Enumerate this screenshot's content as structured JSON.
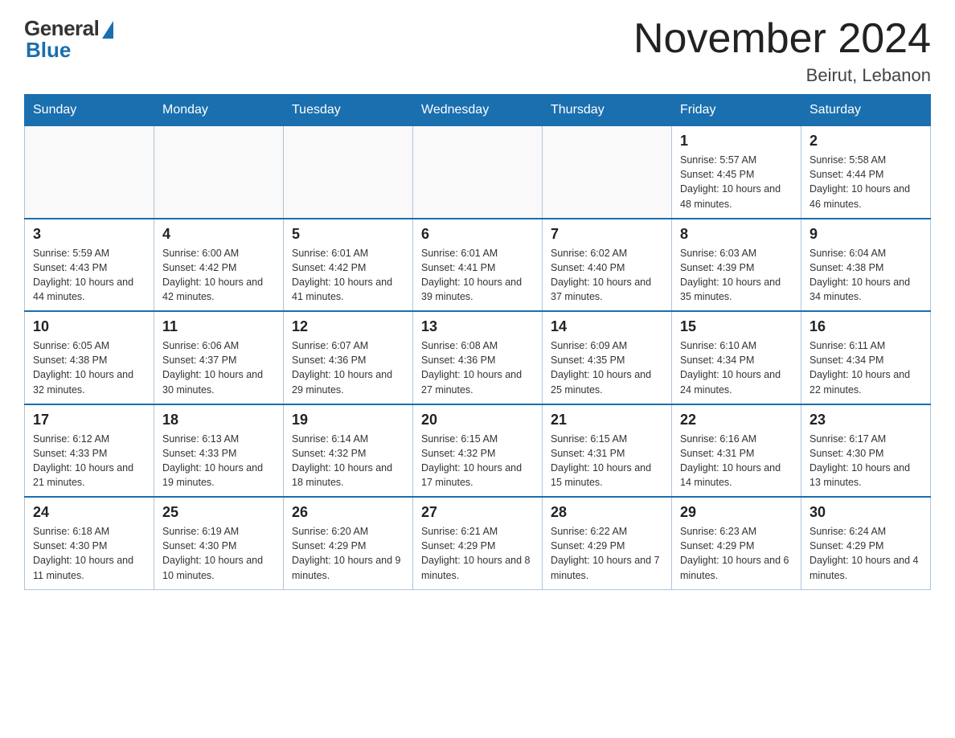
{
  "logo": {
    "general": "General",
    "blue": "Blue"
  },
  "header": {
    "month_year": "November 2024",
    "location": "Beirut, Lebanon"
  },
  "weekdays": [
    "Sunday",
    "Monday",
    "Tuesday",
    "Wednesday",
    "Thursday",
    "Friday",
    "Saturday"
  ],
  "weeks": [
    [
      {
        "day": "",
        "info": ""
      },
      {
        "day": "",
        "info": ""
      },
      {
        "day": "",
        "info": ""
      },
      {
        "day": "",
        "info": ""
      },
      {
        "day": "",
        "info": ""
      },
      {
        "day": "1",
        "info": "Sunrise: 5:57 AM\nSunset: 4:45 PM\nDaylight: 10 hours and 48 minutes."
      },
      {
        "day": "2",
        "info": "Sunrise: 5:58 AM\nSunset: 4:44 PM\nDaylight: 10 hours and 46 minutes."
      }
    ],
    [
      {
        "day": "3",
        "info": "Sunrise: 5:59 AM\nSunset: 4:43 PM\nDaylight: 10 hours and 44 minutes."
      },
      {
        "day": "4",
        "info": "Sunrise: 6:00 AM\nSunset: 4:42 PM\nDaylight: 10 hours and 42 minutes."
      },
      {
        "day": "5",
        "info": "Sunrise: 6:01 AM\nSunset: 4:42 PM\nDaylight: 10 hours and 41 minutes."
      },
      {
        "day": "6",
        "info": "Sunrise: 6:01 AM\nSunset: 4:41 PM\nDaylight: 10 hours and 39 minutes."
      },
      {
        "day": "7",
        "info": "Sunrise: 6:02 AM\nSunset: 4:40 PM\nDaylight: 10 hours and 37 minutes."
      },
      {
        "day": "8",
        "info": "Sunrise: 6:03 AM\nSunset: 4:39 PM\nDaylight: 10 hours and 35 minutes."
      },
      {
        "day": "9",
        "info": "Sunrise: 6:04 AM\nSunset: 4:38 PM\nDaylight: 10 hours and 34 minutes."
      }
    ],
    [
      {
        "day": "10",
        "info": "Sunrise: 6:05 AM\nSunset: 4:38 PM\nDaylight: 10 hours and 32 minutes."
      },
      {
        "day": "11",
        "info": "Sunrise: 6:06 AM\nSunset: 4:37 PM\nDaylight: 10 hours and 30 minutes."
      },
      {
        "day": "12",
        "info": "Sunrise: 6:07 AM\nSunset: 4:36 PM\nDaylight: 10 hours and 29 minutes."
      },
      {
        "day": "13",
        "info": "Sunrise: 6:08 AM\nSunset: 4:36 PM\nDaylight: 10 hours and 27 minutes."
      },
      {
        "day": "14",
        "info": "Sunrise: 6:09 AM\nSunset: 4:35 PM\nDaylight: 10 hours and 25 minutes."
      },
      {
        "day": "15",
        "info": "Sunrise: 6:10 AM\nSunset: 4:34 PM\nDaylight: 10 hours and 24 minutes."
      },
      {
        "day": "16",
        "info": "Sunrise: 6:11 AM\nSunset: 4:34 PM\nDaylight: 10 hours and 22 minutes."
      }
    ],
    [
      {
        "day": "17",
        "info": "Sunrise: 6:12 AM\nSunset: 4:33 PM\nDaylight: 10 hours and 21 minutes."
      },
      {
        "day": "18",
        "info": "Sunrise: 6:13 AM\nSunset: 4:33 PM\nDaylight: 10 hours and 19 minutes."
      },
      {
        "day": "19",
        "info": "Sunrise: 6:14 AM\nSunset: 4:32 PM\nDaylight: 10 hours and 18 minutes."
      },
      {
        "day": "20",
        "info": "Sunrise: 6:15 AM\nSunset: 4:32 PM\nDaylight: 10 hours and 17 minutes."
      },
      {
        "day": "21",
        "info": "Sunrise: 6:15 AM\nSunset: 4:31 PM\nDaylight: 10 hours and 15 minutes."
      },
      {
        "day": "22",
        "info": "Sunrise: 6:16 AM\nSunset: 4:31 PM\nDaylight: 10 hours and 14 minutes."
      },
      {
        "day": "23",
        "info": "Sunrise: 6:17 AM\nSunset: 4:30 PM\nDaylight: 10 hours and 13 minutes."
      }
    ],
    [
      {
        "day": "24",
        "info": "Sunrise: 6:18 AM\nSunset: 4:30 PM\nDaylight: 10 hours and 11 minutes."
      },
      {
        "day": "25",
        "info": "Sunrise: 6:19 AM\nSunset: 4:30 PM\nDaylight: 10 hours and 10 minutes."
      },
      {
        "day": "26",
        "info": "Sunrise: 6:20 AM\nSunset: 4:29 PM\nDaylight: 10 hours and 9 minutes."
      },
      {
        "day": "27",
        "info": "Sunrise: 6:21 AM\nSunset: 4:29 PM\nDaylight: 10 hours and 8 minutes."
      },
      {
        "day": "28",
        "info": "Sunrise: 6:22 AM\nSunset: 4:29 PM\nDaylight: 10 hours and 7 minutes."
      },
      {
        "day": "29",
        "info": "Sunrise: 6:23 AM\nSunset: 4:29 PM\nDaylight: 10 hours and 6 minutes."
      },
      {
        "day": "30",
        "info": "Sunrise: 6:24 AM\nSunset: 4:29 PM\nDaylight: 10 hours and 4 minutes."
      }
    ]
  ]
}
